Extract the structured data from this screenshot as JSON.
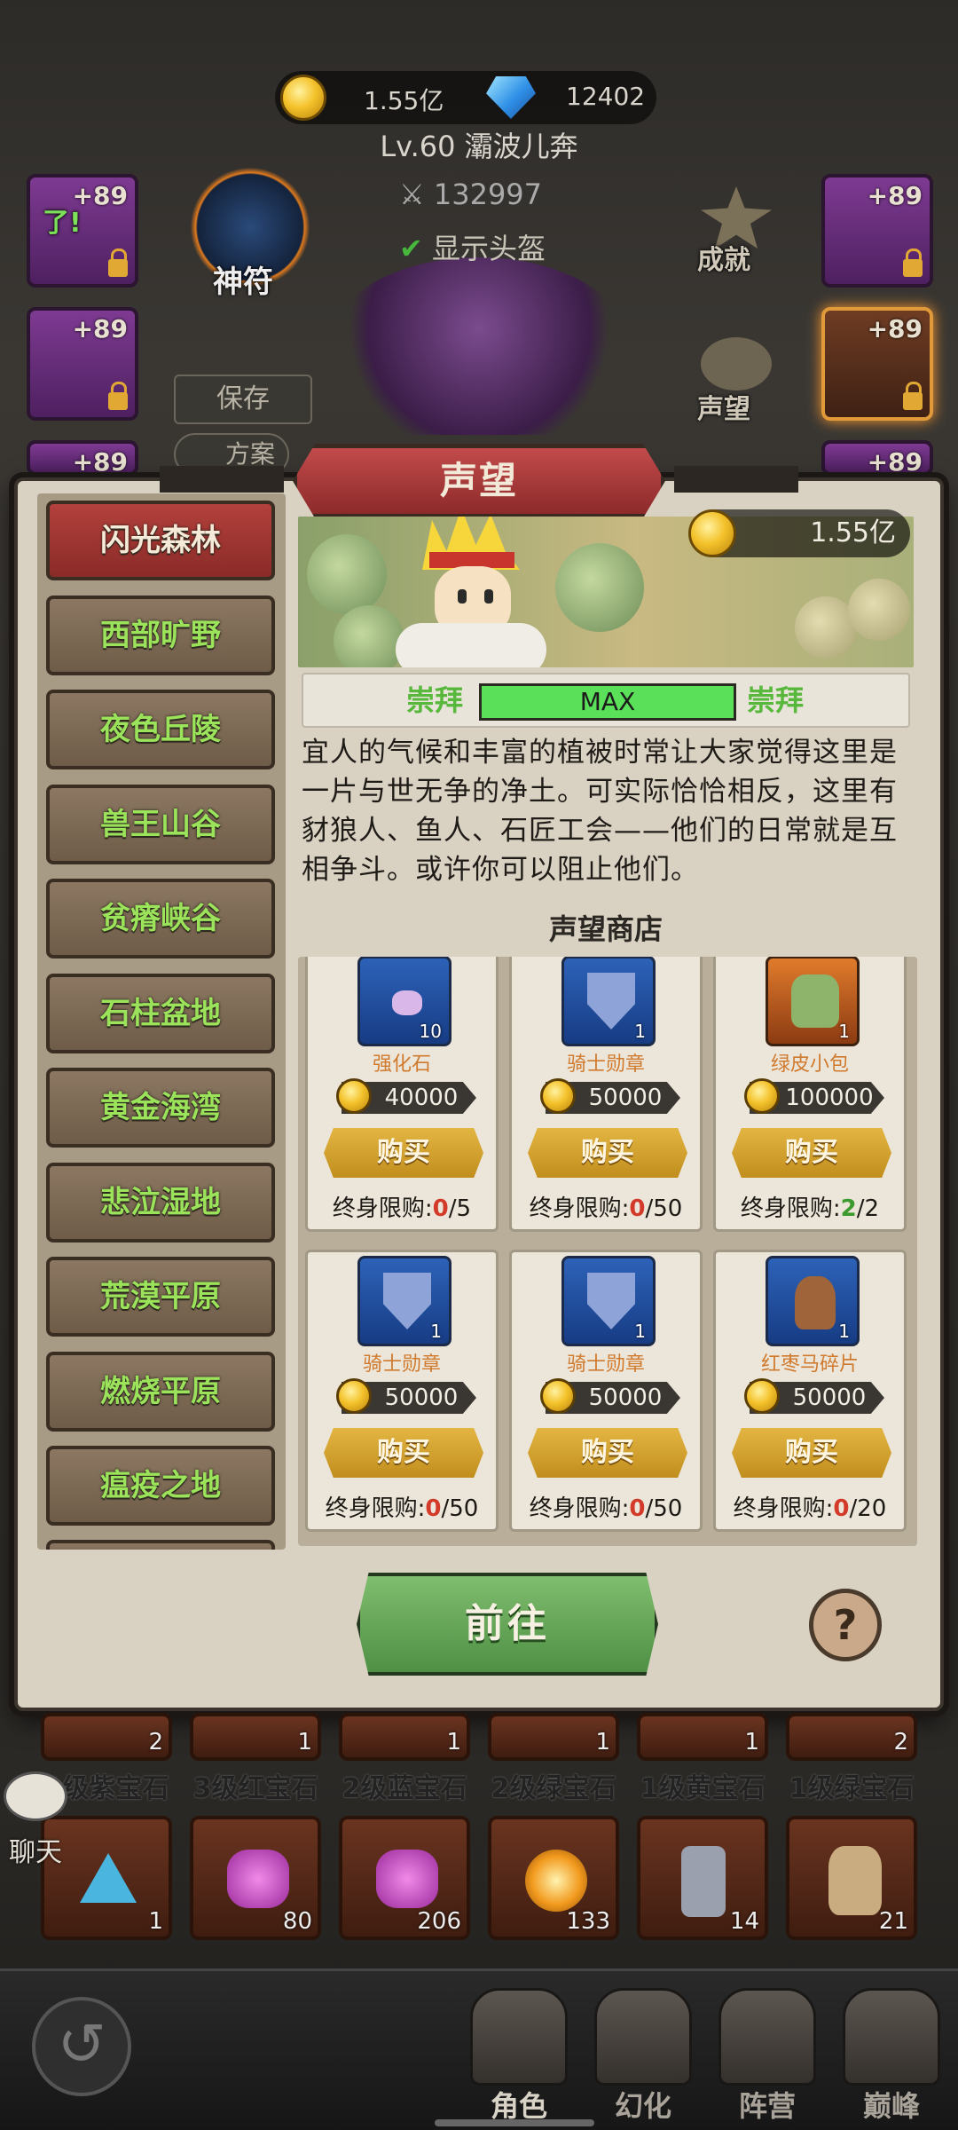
{
  "top": {
    "gold": "1.55亿",
    "gems": "12402",
    "level_name": "Lv.60 灞波儿奔",
    "power": "132997",
    "show_helmet": "显示头盔",
    "save_label": "保存",
    "plan_label": "方案",
    "rune_label": "神符",
    "achievement_label": "成就",
    "reputation_label": "声望",
    "slot_plus": "+89",
    "slot_badge": "了!"
  },
  "popup": {
    "title": "声望",
    "gold": "1.55亿",
    "rep_left": "崇拜",
    "rep_bar": "MAX",
    "rep_right": "崇拜",
    "description": "宜人的气候和丰富的植被时常让大家觉得这里是一片与世无争的净土。可实际恰恰相反，这里有豺狼人、鱼人、石匠工会——他们的日常就是互相争斗。或许你可以阻止他们。",
    "shop_title": "声望商店",
    "goto_label": "前往",
    "help_label": "?",
    "limit_prefix": "终身限购:",
    "buy_label": "购买"
  },
  "regions": [
    {
      "label": "闪光森林",
      "active": true
    },
    {
      "label": "西部旷野"
    },
    {
      "label": "夜色丘陵"
    },
    {
      "label": "兽王山谷"
    },
    {
      "label": "贫瘠峡谷"
    },
    {
      "label": "石柱盆地"
    },
    {
      "label": "黄金海湾"
    },
    {
      "label": "悲泣湿地"
    },
    {
      "label": "荒漠平原"
    },
    {
      "label": "燃烧平原"
    },
    {
      "label": "瘟疫之地"
    }
  ],
  "shop_items": [
    {
      "name": "强化石",
      "count": "10",
      "price": "40000",
      "bought": "0",
      "limit": "/5",
      "icon": "crystal-icon"
    },
    {
      "name": "骑士勋章",
      "count": "1",
      "price": "50000",
      "bought": "0",
      "limit": "/50",
      "icon": "shield-icon"
    },
    {
      "name": "绿皮小包",
      "count": "1",
      "price": "100000",
      "bought": "2",
      "limit": "/2",
      "icon": "bag-icon"
    },
    {
      "name": "骑士勋章",
      "count": "1",
      "price": "50000",
      "bought": "0",
      "limit": "/50",
      "icon": "shield-icon"
    },
    {
      "name": "骑士勋章",
      "count": "1",
      "price": "50000",
      "bought": "0",
      "limit": "/50",
      "icon": "shield-icon"
    },
    {
      "name": "红枣马碎片",
      "count": "1",
      "price": "50000",
      "bought": "0",
      "limit": "/20",
      "icon": "horse-icon"
    }
  ],
  "inventory_row1": [
    {
      "count": "2",
      "label": "1级紫宝石"
    },
    {
      "count": "1",
      "label": "3级红宝石"
    },
    {
      "count": "1",
      "label": "2级蓝宝石"
    },
    {
      "count": "1",
      "label": "2级绿宝石"
    },
    {
      "count": "1",
      "label": "1级黄宝石"
    },
    {
      "count": "2",
      "label": "1级绿宝石"
    }
  ],
  "inventory_row2": [
    {
      "count": "1"
    },
    {
      "count": "80"
    },
    {
      "count": "206"
    },
    {
      "count": "133"
    },
    {
      "count": "14"
    },
    {
      "count": "21"
    }
  ],
  "chat_label": "聊天",
  "nav": [
    {
      "label": "角色",
      "active": true
    },
    {
      "label": "幻化"
    },
    {
      "label": "阵营"
    },
    {
      "label": "巅峰"
    }
  ],
  "colors": {
    "bought_zero": "#d33a2a",
    "bought_full": "#3c9a2e",
    "region_text": "#9ae35a"
  }
}
